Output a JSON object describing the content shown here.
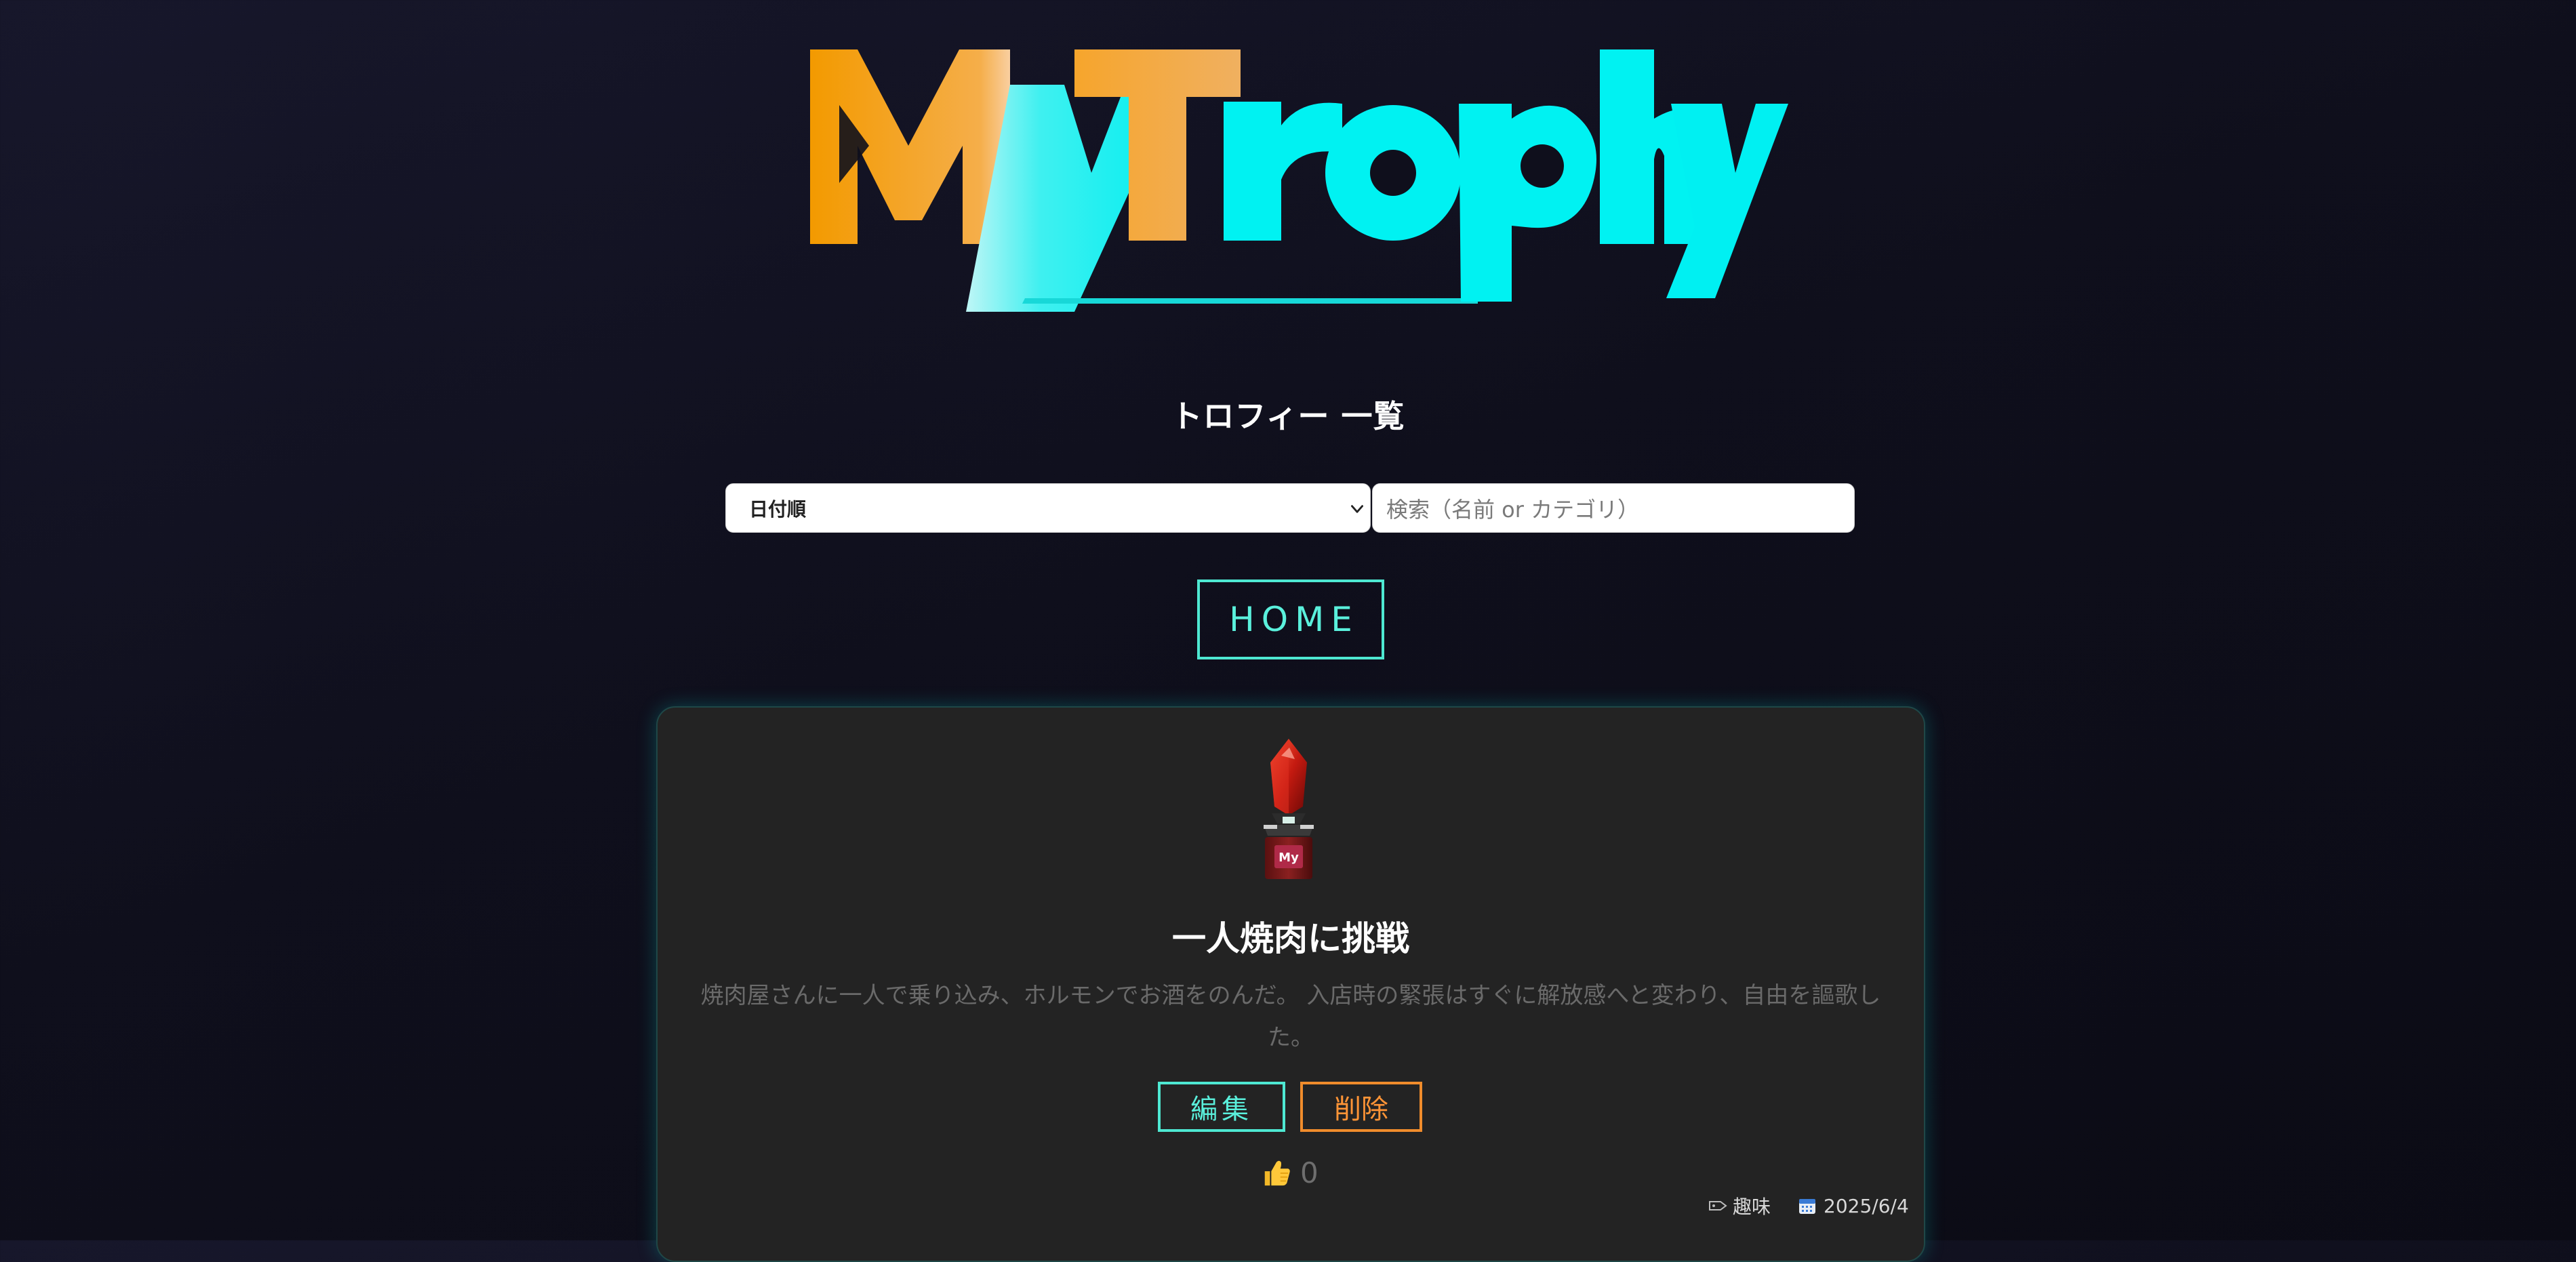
{
  "logo": {
    "text": "MyTrophy",
    "colors": {
      "primary": "#00f2f2",
      "secondary": "#f5a623"
    }
  },
  "page": {
    "title": "トロフィー 一覧"
  },
  "controls": {
    "sort_select": {
      "selected": "日付順"
    },
    "search": {
      "placeholder": "検索（名前 or カテゴリ）"
    },
    "home_label": "HOME"
  },
  "trophies": [
    {
      "name": "一人焼肉に挑戦",
      "description": "焼肉屋さんに一人で乗り込み、ホルモンでお酒をのんだ。 入店時の緊張はすぐに解放感へと変わり、自由を謳歌した。",
      "edit_label": "編集",
      "delete_label": "削除",
      "likes": "0",
      "category": "趣味",
      "date": "2025/6/4",
      "icons": {
        "like": "thumbs-up-icon",
        "category": "tag-icon",
        "date": "calendar-icon"
      }
    }
  ],
  "colors": {
    "accent_cyan": "#4ee8d2",
    "accent_orange": "#f08c2c",
    "card_bg": "#232323",
    "page_bg": "#13131f"
  }
}
